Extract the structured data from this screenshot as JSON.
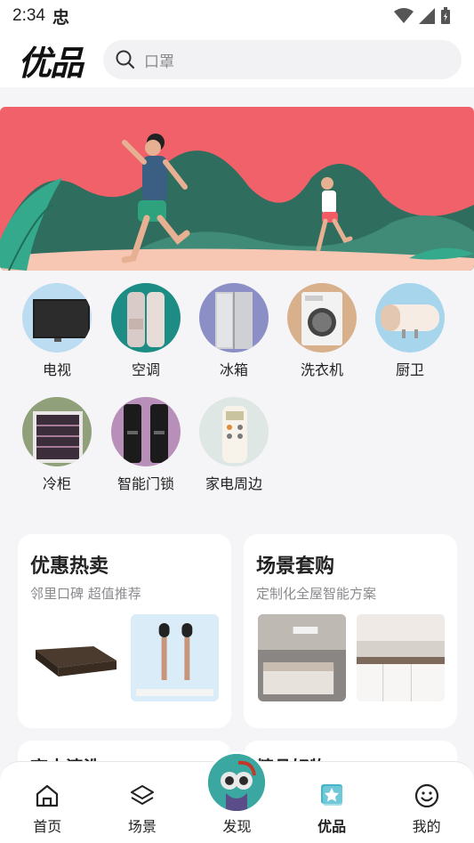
{
  "status_bar": {
    "time": "2:34",
    "notification_glyph": "忠"
  },
  "header": {
    "logo_text": "优品",
    "search_placeholder": "口罩"
  },
  "categories": [
    {
      "label": "电视",
      "icon": "tv-icon"
    },
    {
      "label": "空调",
      "icon": "air-conditioner-icon"
    },
    {
      "label": "冰箱",
      "icon": "refrigerator-icon"
    },
    {
      "label": "洗衣机",
      "icon": "washing-machine-icon"
    },
    {
      "label": "厨卫",
      "icon": "water-heater-icon"
    },
    {
      "label": "冷柜",
      "icon": "wine-cabinet-icon"
    },
    {
      "label": "智能门锁",
      "icon": "smart-lock-icon"
    },
    {
      "label": "家电周边",
      "icon": "remote-control-icon"
    }
  ],
  "cards": {
    "promo": {
      "title": "优惠热卖",
      "subtitle": "邻里口碑 超值推荐"
    },
    "scenes": {
      "title": "场景套购",
      "subtitle": "定制化全屋智能方案"
    }
  },
  "peek_cards": [
    "高士清洗",
    "精品好物"
  ],
  "bottom_nav": [
    {
      "label": "首页",
      "icon": "home-icon",
      "active": false
    },
    {
      "label": "场景",
      "icon": "layers-icon",
      "active": false
    },
    {
      "label": "发现",
      "icon": "discover-avatar",
      "active": false
    },
    {
      "label": "优品",
      "icon": "star-bag-icon",
      "active": true
    },
    {
      "label": "我的",
      "icon": "smiley-icon",
      "active": false
    }
  ],
  "colors": {
    "banner_bg": "#f0616a",
    "mountain": "#2f6d5e",
    "accent_teal": "#3aa8a0"
  }
}
